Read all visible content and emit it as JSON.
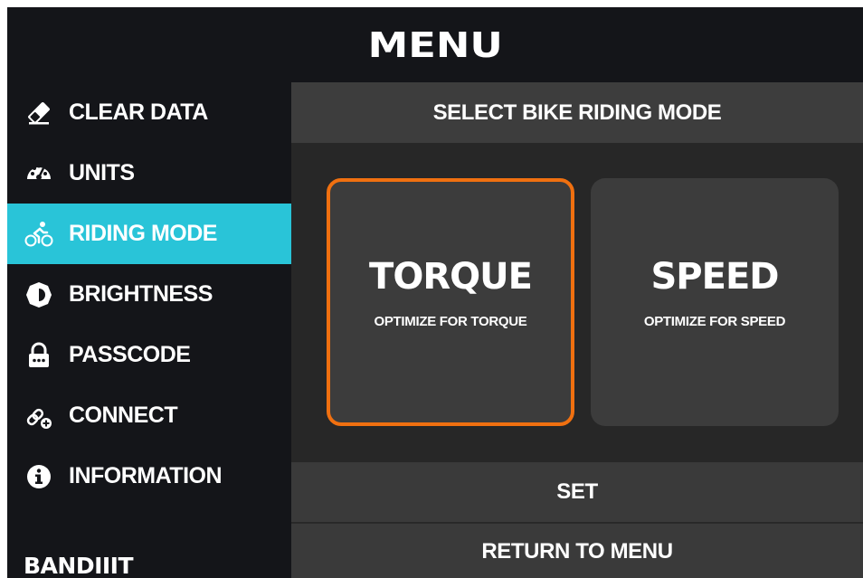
{
  "header": {
    "title": "MENU"
  },
  "sidebar": {
    "items": [
      {
        "label": "CLEAR DATA",
        "icon": "eraser-icon"
      },
      {
        "label": "UNITS",
        "icon": "speedometer-icon"
      },
      {
        "label": "RIDING MODE",
        "icon": "cyclist-icon",
        "active": true
      },
      {
        "label": "BRIGHTNESS",
        "icon": "brightness-icon"
      },
      {
        "label": "PASSCODE",
        "icon": "lock-icon"
      },
      {
        "label": "CONNECT",
        "icon": "link-add-icon"
      },
      {
        "label": "INFORMATION",
        "icon": "info-icon"
      }
    ],
    "logo": "BANDIIIT",
    "active_color": "#29c4d8"
  },
  "main": {
    "title": "SELECT BIKE RIDING MODE",
    "modes": [
      {
        "title": "TORQUE",
        "subtitle": "OPTIMIZE FOR TORQUE",
        "selected": true
      },
      {
        "title": "SPEED",
        "subtitle": "OPTIMIZE FOR SPEED",
        "selected": false
      }
    ],
    "set_label": "SET",
    "return_label": "RETURN TO MENU",
    "selection_color": "#f07010"
  }
}
